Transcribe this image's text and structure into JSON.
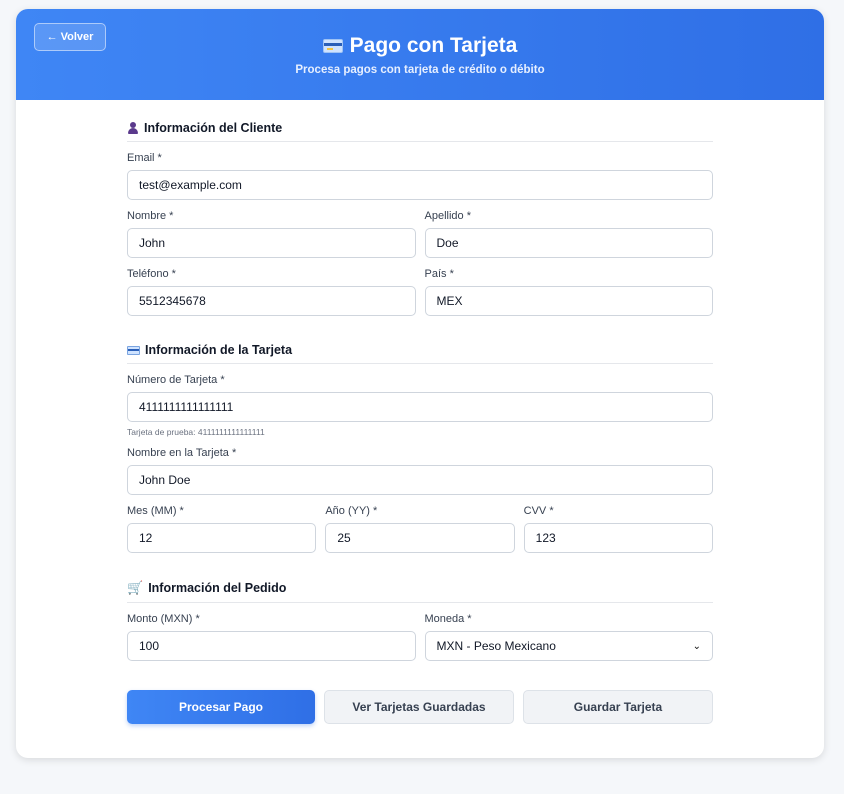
{
  "header": {
    "back_label": "← Volver",
    "title": "Pago con Tarjeta",
    "subtitle": "Procesa pagos con tarjeta de crédito o débito",
    "accent": "#2f6fe6"
  },
  "customer": {
    "section_title": "Información del Cliente",
    "email_label": "Email *",
    "email_value": "test@example.com",
    "first_name_label": "Nombre *",
    "first_name_value": "John",
    "last_name_label": "Apellido *",
    "last_name_value": "Doe",
    "phone_label": "Teléfono *",
    "phone_value": "5512345678",
    "country_label": "País *",
    "country_value": "MEX"
  },
  "card": {
    "section_title": "Información de la Tarjeta",
    "number_label": "Número de Tarjeta *",
    "number_value": "4111111111111111",
    "number_hint": "Tarjeta de prueba: 4111111111111111",
    "holder_label": "Nombre en la Tarjeta *",
    "holder_value": "John Doe",
    "month_label": "Mes (MM) *",
    "month_value": "12",
    "year_label": "Año (YY) *",
    "year_value": "25",
    "cvv_label": "CVV *",
    "cvv_value": "123"
  },
  "order": {
    "section_title": "Información del Pedido",
    "amount_label": "Monto (MXN) *",
    "amount_value": "100",
    "currency_label": "Moneda *",
    "currency_value": "MXN - Peso Mexicano"
  },
  "actions": {
    "process_label": "Procesar Pago",
    "view_saved_label": "Ver Tarjetas Guardadas",
    "save_card_label": "Guardar Tarjeta"
  }
}
